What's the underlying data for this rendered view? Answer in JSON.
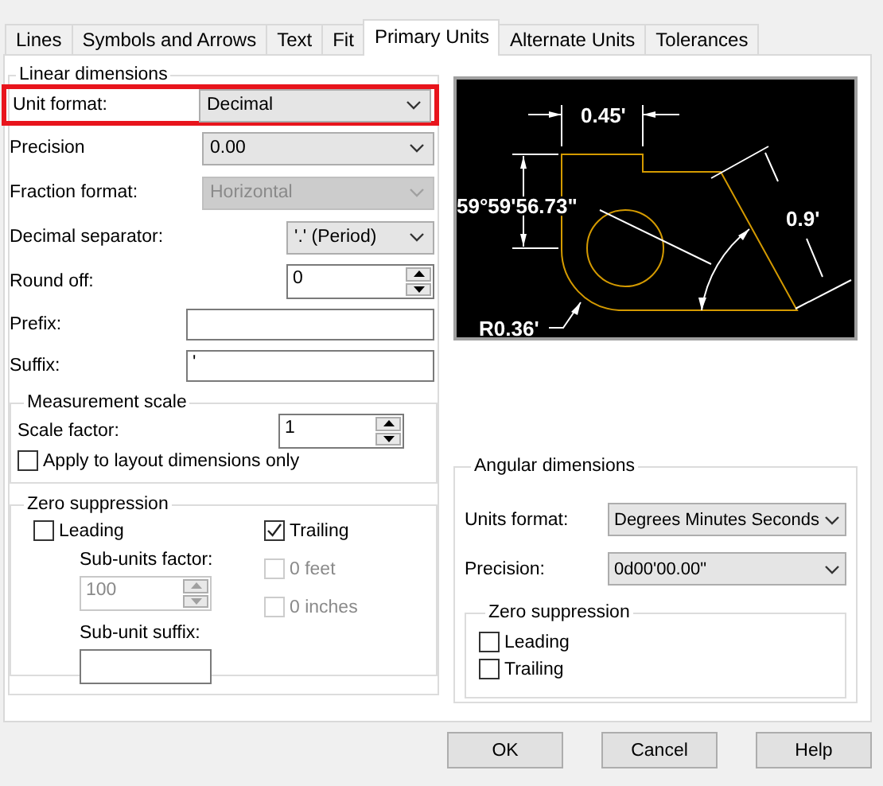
{
  "tabs": [
    {
      "label": "Lines",
      "selected": false
    },
    {
      "label": "Symbols and Arrows",
      "selected": false
    },
    {
      "label": "Text",
      "selected": false
    },
    {
      "label": "Fit",
      "selected": false
    },
    {
      "label": "Primary Units",
      "selected": true
    },
    {
      "label": "Alternate Units",
      "selected": false
    },
    {
      "label": "Tolerances",
      "selected": false
    }
  ],
  "linear_dimensions": {
    "title": "Linear dimensions",
    "fields": [
      {
        "kind": "dropdown",
        "label": "Unit format:",
        "value": "Decimal",
        "disabled": false,
        "highlighted": true
      },
      {
        "kind": "dropdown",
        "label": "Precision",
        "value": "0.00",
        "disabled": false,
        "highlighted": false
      },
      {
        "kind": "dropdown",
        "label": "Fraction format:",
        "value": "Horizontal",
        "disabled": true,
        "highlighted": false
      },
      {
        "kind": "dropdown",
        "label": "Decimal separator:",
        "value": "'.' (Period)",
        "disabled": false,
        "highlighted": false
      },
      {
        "kind": "spin",
        "label": "Round off:",
        "value": "0",
        "disabled": false,
        "highlighted": false
      },
      {
        "kind": "text",
        "label": "Prefix:",
        "disabled": false,
        "highlighted": false
      },
      {
        "kind": "text",
        "label": "Suffix:",
        "value": "'",
        "disabled": false,
        "highlighted": false
      }
    ],
    "measurement_scale": {
      "title": "Measurement scale",
      "scale_factor": {
        "label": "Scale factor:",
        "value": "1"
      },
      "apply_to_layout": {
        "label": "Apply to layout dimensions only",
        "checked": false
      }
    },
    "zero_suppression": {
      "title": "Zero suppression",
      "leading": {
        "label": "Leading",
        "checked": false
      },
      "trailing": {
        "label": "Trailing",
        "checked": true,
        "disabled": false
      },
      "sub_units_factor": {
        "label": "Sub-units factor:",
        "value": "100",
        "disabled": true
      },
      "feet": {
        "label": "0 feet",
        "checked": false,
        "disabled": true
      },
      "inches": {
        "label": "0 inches",
        "checked": false,
        "disabled": true
      },
      "sub_unit_suffix": {
        "label": "Sub-unit suffix:"
      }
    }
  },
  "preview": {
    "labels": [
      "0.45'",
      "59°59'56.73\"",
      "0.9'",
      "R0.36'"
    ]
  },
  "angular_dimensions": {
    "title": "Angular dimensions",
    "fields": [
      {
        "label": "Units format:",
        "value": "Degrees Minutes Seconds"
      },
      {
        "label": "Precision:",
        "value": "0d00'00.00\""
      }
    ],
    "zero_suppression": {
      "title": "Zero suppression",
      "options": [
        {
          "label": "Leading",
          "checked": false
        },
        {
          "label": "Trailing",
          "checked": false
        }
      ]
    }
  },
  "buttons": [
    "OK",
    "Cancel",
    "Help"
  ]
}
